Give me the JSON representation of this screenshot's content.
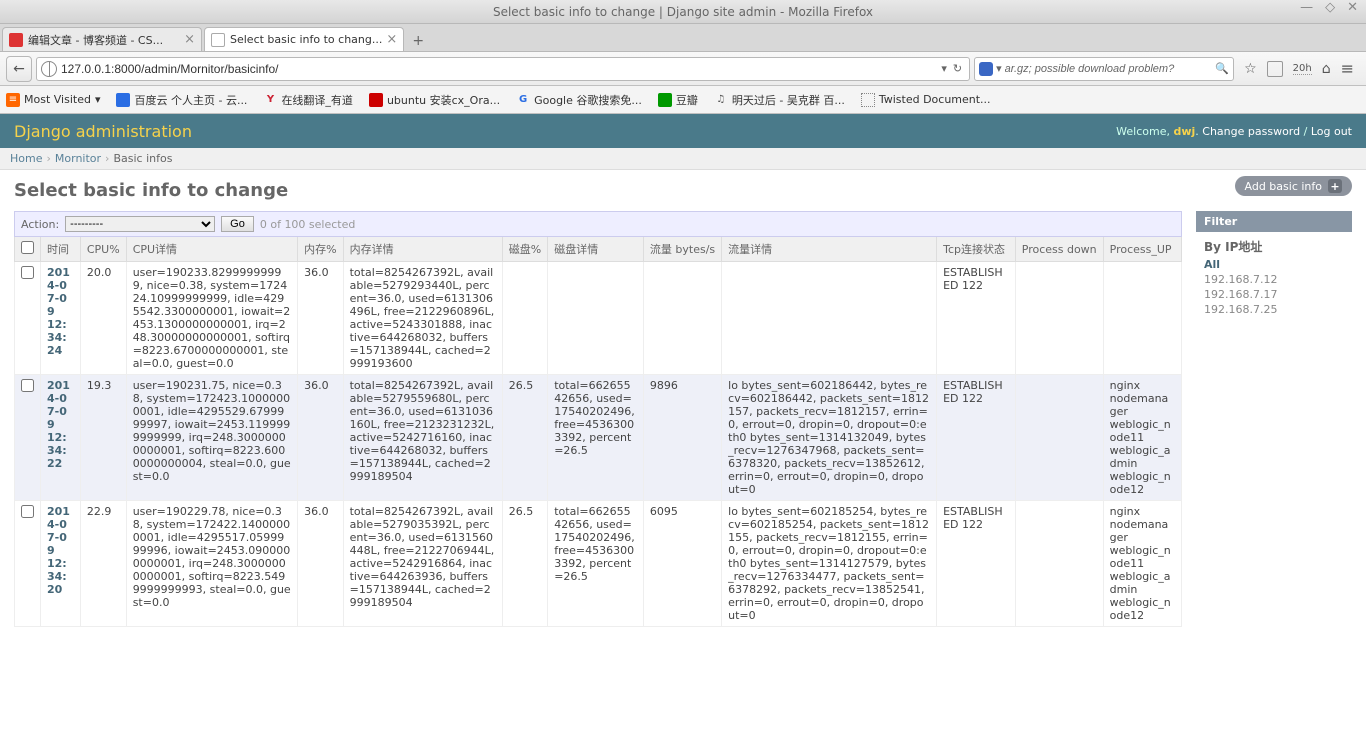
{
  "window": {
    "title": "Select basic info to change | Django site admin - Mozilla Firefox"
  },
  "tabs": [
    {
      "label": "编辑文章 - 博客频道 - CS...",
      "active": false,
      "favicon": "csdn"
    },
    {
      "label": "Select basic info to chang...",
      "active": true,
      "favicon": "django"
    }
  ],
  "url": "127.0.0.1:8000/admin/Mornitor/basicinfo/",
  "search_placeholder": "ar.gz; possible download problem?",
  "zoom_label": "20h",
  "bookmarks": {
    "most_visited": "Most Visited",
    "items": [
      {
        "icon": "baidu",
        "label": "百度云 个人主页 - 云..."
      },
      {
        "icon": "youdao",
        "label": "在线翻译_有道"
      },
      {
        "icon": "ubuntu",
        "label": "ubuntu 安装cx_Ora..."
      },
      {
        "icon": "google",
        "label": "Google 谷歌搜索免..."
      },
      {
        "icon": "douban",
        "label": "豆瓣"
      },
      {
        "icon": "music",
        "label": "明天过后 - 吴克群 百..."
      },
      {
        "icon": "twisted",
        "label": "Twisted Document..."
      }
    ]
  },
  "django": {
    "brand": "Django administration",
    "welcome": "Welcome,",
    "user": "dwj",
    "change_pw": "Change password",
    "logout": "Log out"
  },
  "breadcrumbs": {
    "home": "Home",
    "app": "Mornitor",
    "model": "Basic infos"
  },
  "page_title": "Select basic info to change",
  "add_button": "Add basic info",
  "actions": {
    "label": "Action:",
    "placeholder": "---------",
    "go": "Go",
    "status": "0 of 100 selected"
  },
  "columns": [
    "时间",
    "CPU%",
    "CPU详情",
    "内存%",
    "内存详情",
    "磁盘%",
    "磁盘详情",
    "流量 bytes/s",
    "流量详情",
    "Tcp连接状态",
    "Process down",
    "Process_UP"
  ],
  "rows": [
    {
      "time": "2014-07-09 12:34:24",
      "cpu_pct": "20.0",
      "cpu_detail": "user=190233.82999999999, nice=0.38, system=172424.10999999999, idle=4295542.3300000001, iowait=2453.1300000000001, irq=248.30000000000001, softirq=8223.6700000000001, steal=0.0, guest=0.0",
      "mem_pct": "36.0",
      "mem_detail": "total=8254267392L, available=5279293440L, percent=36.0, used=6131306496L, free=2122960896L, active=5243301888, inactive=644268032, buffers=157138944L, cached=2999193600",
      "disk_pct": "",
      "disk_detail": "",
      "traffic": "",
      "traffic_detail": "",
      "tcp": "ESTABLISHED 122",
      "proc_down": "",
      "proc_up": ""
    },
    {
      "time": "2014-07-09 12:34:22",
      "cpu_pct": "19.3",
      "cpu_detail": "user=190231.75, nice=0.38, system=172423.10000000001, idle=4295529.6799999997, iowait=2453.1199999999999, irq=248.30000000000001, softirq=8223.6000000000004, steal=0.0, guest=0.0",
      "mem_pct": "36.0",
      "mem_detail": "total=8254267392L, available=5279559680L, percent=36.0, used=6131036160L, free=2123231232L, active=5242716160, inactive=644268032, buffers=157138944L, cached=2999189504",
      "disk_pct": "26.5",
      "disk_detail": "total=66265542656, used=17540202496, free=45363003392, percent=26.5",
      "traffic": "9896",
      "traffic_detail": "lo bytes_sent=602186442, bytes_recv=602186442, packets_sent=1812157, packets_recv=1812157, errin=0, errout=0, dropin=0, dropout=0:eth0 bytes_sent=1314132049, bytes_recv=1276347968, packets_sent=6378320, packets_recv=13852612, errin=0, errout=0, dropin=0, dropout=0",
      "tcp": "ESTABLISHED 122",
      "proc_down": "",
      "proc_up": "nginx\nnodemanager\nweblogic_node11\nweblogic_admin\nweblogic_node12"
    },
    {
      "time": "2014-07-09 12:34:20",
      "cpu_pct": "22.9",
      "cpu_detail": "user=190229.78, nice=0.38, system=172422.14000000001, idle=4295517.0599999996, iowait=2453.0900000000001, irq=248.30000000000001, softirq=8223.5499999999993, steal=0.0, guest=0.0",
      "mem_pct": "36.0",
      "mem_detail": "total=8254267392L, available=5279035392L, percent=36.0, used=6131560448L, free=2122706944L, active=5242916864, inactive=644263936, buffers=157138944L, cached=2999189504",
      "disk_pct": "26.5",
      "disk_detail": "total=66265542656, used=17540202496, free=45363003392, percent=26.5",
      "traffic": "6095",
      "traffic_detail": "lo bytes_sent=602185254, bytes_recv=602185254, packets_sent=1812155, packets_recv=1812155, errin=0, errout=0, dropin=0, dropout=0:eth0 bytes_sent=1314127579, bytes_recv=1276334477, packets_sent=6378292, packets_recv=13852541, errin=0, errout=0, dropin=0, dropout=0",
      "tcp": "ESTABLISHED 122",
      "proc_down": "",
      "proc_up": "nginx\nnodemanager\nweblogic_node11\nweblogic_admin\nweblogic_node12"
    }
  ],
  "filter": {
    "title": "Filter",
    "by_label": "By IP地址",
    "items": [
      "All",
      "192.168.7.12",
      "192.168.7.17",
      "192.168.7.25"
    ],
    "selected": "All"
  }
}
